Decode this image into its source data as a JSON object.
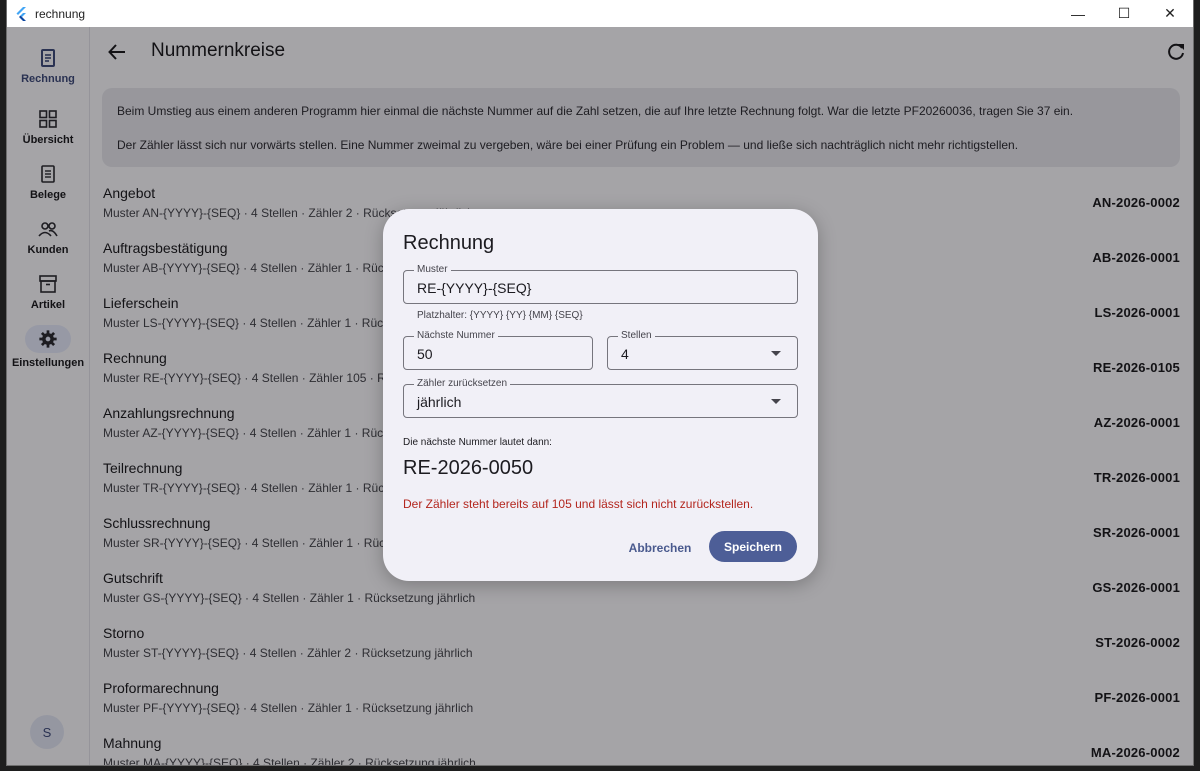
{
  "window": {
    "title": "rechnung",
    "controls": {
      "minimize": "—",
      "maximize": "☐",
      "close": "✕"
    }
  },
  "nav": {
    "items": [
      {
        "label": "Rechnung",
        "icon": "receipt-icon"
      },
      {
        "label": "Übersicht",
        "icon": "dashboard-icon"
      },
      {
        "label": "Belege",
        "icon": "document-icon"
      },
      {
        "label": "Kunden",
        "icon": "people-icon"
      },
      {
        "label": "Artikel",
        "icon": "archive-icon"
      },
      {
        "label": "Einstellungen",
        "icon": "gear-icon",
        "active": true
      }
    ],
    "avatar": "S"
  },
  "appbar": {
    "title": "Nummernkreise"
  },
  "info": {
    "line1": "Beim Umstieg aus einem anderen Programm hier einmal die nächste Nummer auf die Zahl setzen, die auf Ihre letzte Rechnung folgt. War die letzte PF20260036, tragen Sie 37 ein.",
    "line2": "Der Zähler lässt sich nur vorwärts stellen. Eine Nummer zweimal zu vergeben, wäre bei einer Prüfung ein Problem — und ließe sich nachträglich nicht mehr richtigstellen."
  },
  "sequences": [
    {
      "name": "Angebot",
      "meta": "Muster AN-{YYYY}-{SEQ} · 4 Stellen · Zähler 2 · Rücksetzung jährlich",
      "next": "AN-2026-0002"
    },
    {
      "name": "Auftragsbestätigung",
      "meta": "Muster AB-{YYYY}-{SEQ} · 4 Stellen · Zähler 1 · Rücksetzung jährlich",
      "next": "AB-2026-0001"
    },
    {
      "name": "Lieferschein",
      "meta": "Muster LS-{YYYY}-{SEQ} · 4 Stellen · Zähler 1 · Rücksetzung jährlich",
      "next": "LS-2026-0001"
    },
    {
      "name": "Rechnung",
      "meta": "Muster RE-{YYYY}-{SEQ} · 4 Stellen · Zähler 105 · Rücksetzung jährlich",
      "next": "RE-2026-0105"
    },
    {
      "name": "Anzahlungsrechnung",
      "meta": "Muster AZ-{YYYY}-{SEQ} · 4 Stellen · Zähler 1 · Rücksetzung jährlich",
      "next": "AZ-2026-0001"
    },
    {
      "name": "Teilrechnung",
      "meta": "Muster TR-{YYYY}-{SEQ} · 4 Stellen · Zähler 1 · Rücksetzung jährlich",
      "next": "TR-2026-0001"
    },
    {
      "name": "Schlussrechnung",
      "meta": "Muster SR-{YYYY}-{SEQ} · 4 Stellen · Zähler 1 · Rücksetzung jährlich",
      "next": "SR-2026-0001"
    },
    {
      "name": "Gutschrift",
      "meta": "Muster GS-{YYYY}-{SEQ} · 4 Stellen · Zähler 1 · Rücksetzung jährlich",
      "next": "GS-2026-0001"
    },
    {
      "name": "Storno",
      "meta": "Muster ST-{YYYY}-{SEQ} · 4 Stellen · Zähler 2 · Rücksetzung jährlich",
      "next": "ST-2026-0002"
    },
    {
      "name": "Proformarechnung",
      "meta": "Muster PF-{YYYY}-{SEQ} · 4 Stellen · Zähler 1 · Rücksetzung jährlich",
      "next": "PF-2026-0001"
    },
    {
      "name": "Mahnung",
      "meta": "Muster MA-{YYYY}-{SEQ} · 4 Stellen · Zähler 2 · Rücksetzung jährlich",
      "next": "MA-2026-0002"
    }
  ],
  "dialog": {
    "title": "Rechnung",
    "pattern": {
      "label": "Muster",
      "value": "RE-{YYYY}-{SEQ}"
    },
    "placeholder_help": "Platzhalter: {YYYY} {YY} {MM} {SEQ}",
    "next_number": {
      "label": "Nächste Nummer",
      "value": "50"
    },
    "digits": {
      "label": "Stellen",
      "value": "4"
    },
    "reset": {
      "label": "Zähler zurücksetzen",
      "value": "jährlich"
    },
    "preview_label": "Die nächste Nummer lautet dann:",
    "preview_value": "RE-2026-0050",
    "error": "Der Zähler steht bereits auf 105 und lässt sich nicht zurückstellen.",
    "cancel": "Abbrechen",
    "save": "Speichern"
  },
  "colors": {
    "accent": "#4d5e97",
    "error": "#b3261e",
    "surface": "#f3f2f7"
  }
}
